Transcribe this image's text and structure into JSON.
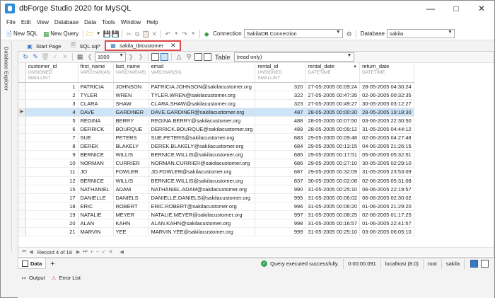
{
  "window": {
    "title": "dbForge Studio 2020 for MySQL"
  },
  "menu": [
    "File",
    "Edit",
    "View",
    "Database",
    "Data",
    "Tools",
    "Window",
    "Help"
  ],
  "toolbar": {
    "new_sql": "New SQL",
    "new_query": "New Query",
    "connection_label": "Connection",
    "connection_value": "SakilaDB Connection",
    "database_label": "Database",
    "database_value": "sakila"
  },
  "sidebar": {
    "label": "Database Explorer"
  },
  "tabs": [
    {
      "label": "Start Page",
      "icon": "start-page-icon",
      "active": false
    },
    {
      "label": "SQL.sql*",
      "icon": "sql-file-icon",
      "active": false
    },
    {
      "label": "sakila_tblcustomer",
      "icon": "table-icon",
      "active": true
    }
  ],
  "grid_toolbar": {
    "page_size": "1000",
    "view_label": "Table",
    "view_mode": "(read only)"
  },
  "grid": {
    "columns": [
      {
        "name": "customer_id",
        "type": "UNSIGNED SMALLINT"
      },
      {
        "name": "first_name",
        "type": "VARCHAR(45)"
      },
      {
        "name": "last_name",
        "type": "VARCHAR(45)"
      },
      {
        "name": "email",
        "type": "VARCHAR(50)"
      },
      {
        "name": "rental_id",
        "type": "UNSIGNED SMALLINT"
      },
      {
        "name": "rental_date",
        "type": "DATETIME"
      },
      {
        "name": "return_date",
        "type": "DATETIME"
      }
    ],
    "selected_row": 3,
    "rows": [
      [
        "1",
        "PATRICIA",
        "JOHNSON",
        "PATRICIA.JOHNSON@sakilacustomer.org",
        "320",
        "27-05-2005 00:09:24",
        "28-05-2005 04:30:24"
      ],
      [
        "2",
        "TYLER",
        "WREN",
        "TYLER.WREN@sakilacustomer.org",
        "322",
        "27-05-2005 00:47:35",
        "02-06-2005 00:32:35"
      ],
      [
        "3",
        "CLARA",
        "SHAW",
        "CLARA.SHAW@sakilacustomer.org",
        "323",
        "27-05-2005 00:49:27",
        "30-05-2005 03:12:27"
      ],
      [
        "4",
        "DAVE",
        "GARDINER",
        "DAVE.GARDINER@sakilacustomer.org",
        "487",
        "28-05-2005 00:00:30",
        "28-05-2005 19:18:30"
      ],
      [
        "5",
        "REGINA",
        "BERRY",
        "REGINA.BERRY@sakilacustomer.org",
        "488",
        "28-05-2005 00:07:50",
        "03-06-2005 22:30:50"
      ],
      [
        "6",
        "DERRICK",
        "BOURQUE",
        "DERRICK.BOURQUE@sakilacustomer.org",
        "489",
        "28-05-2005 00:09:12",
        "31-05-2005 04:44:12"
      ],
      [
        "7",
        "SUE",
        "PETERS",
        "SUE.PETERS@sakilacustomer.org",
        "683",
        "29-05-2005 00:09:48",
        "02-06-2005 04:27:48"
      ],
      [
        "8",
        "DEREK",
        "BLAKELY",
        "DEREK.BLAKELY@sakilacustomer.org",
        "684",
        "29-05-2005 00:13:15",
        "04-06-2005 21:26:15"
      ],
      [
        "9",
        "BERNICE",
        "WILLIS",
        "BERNICE.WILLIS@sakilacustomer.org",
        "685",
        "29-05-2005 00:17:51",
        "05-06-2005 05:32:51"
      ],
      [
        "10",
        "NORMAN",
        "CURRIER",
        "NORMAN.CURRIER@sakilacustomer.org",
        "686",
        "29-05-2005 00:27:10",
        "30-05-2005 02:29:10"
      ],
      [
        "11",
        "JO",
        "FOWLER",
        "JO.FOWLER@sakilacustomer.org",
        "687",
        "29-05-2005 00:32:09",
        "31-05-2005 23:53:09"
      ],
      [
        "12",
        "BERNICE",
        "WILLIS",
        "BERNICE.WILLIS@sakilacustomer.org",
        "837",
        "30-05-2005 00:02:08",
        "02-06-2005 05:31:08"
      ],
      [
        "15",
        "NATHANIEL",
        "ADAM",
        "NATHANIEL.ADAM@sakilacustomer.org",
        "990",
        "31-05-2005 00:25:10",
        "06-06-2005 22:19:57"
      ],
      [
        "17",
        "DANIELLE",
        "DANIELS",
        "DANIELLE.DANIELS@sakilacustomer.org",
        "995",
        "31-05-2005 00:06:02",
        "06-06-2005 02:30:02"
      ],
      [
        "18",
        "ERIC",
        "ROBERT",
        "ERIC.ROBERT@sakilacustomer.org",
        "996",
        "31-05-2005 00:06:20",
        "01-06-2005 21:29:20"
      ],
      [
        "19",
        "NATALIE",
        "MEYER",
        "NATALIE.MEYER@sakilacustomer.org",
        "997",
        "31-05-2005 00:08:25",
        "02-06-2005 01:17:25"
      ],
      [
        "20",
        "ALAN",
        "KAHN",
        "ALAN.KAHN@sakilacustomer.org",
        "998",
        "31-05-2005 00:16:57",
        "01-06-2005 22:41:57"
      ],
      [
        "21",
        "MARVIN",
        "YEE",
        "MARVIN.YEE@sakilacustomer.org",
        "999",
        "31-05-2005 00:25:10",
        "03-06-2005 06:05:10"
      ]
    ]
  },
  "navigator": {
    "record_text": "Record 4 of 18"
  },
  "results": {
    "tab_label": "Data",
    "status_message": "Query executed successfully.",
    "elapsed": "0:00:00.091",
    "server": "localhost (8.0)",
    "user": "root",
    "database": "sakila"
  },
  "output": {
    "output_label": "Output",
    "error_list_label": "Error List"
  }
}
